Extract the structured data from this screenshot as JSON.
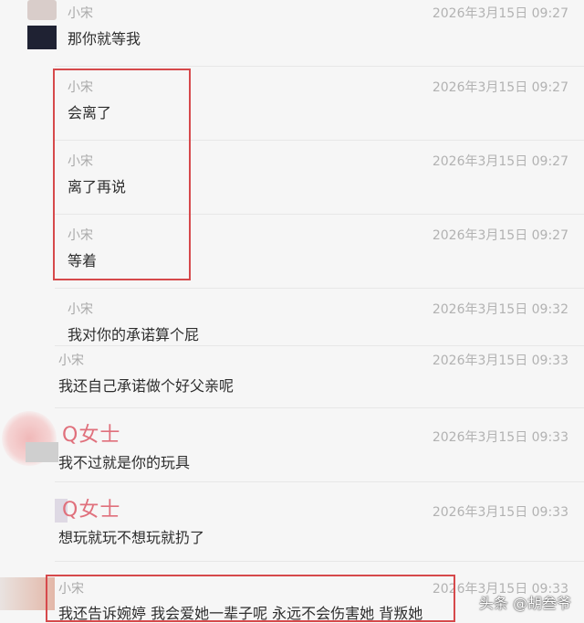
{
  "messages": [
    {
      "sender": "小宋",
      "time": "2026年3月15日 09:27",
      "text": "那你就等我"
    },
    {
      "sender": "小宋",
      "time": "2026年3月15日 09:27",
      "text": "会离了"
    },
    {
      "sender": "小宋",
      "time": "2026年3月15日 09:27",
      "text": "离了再说"
    },
    {
      "sender": "小宋",
      "time": "2026年3月15日 09:27",
      "text": "等着"
    },
    {
      "sender": "小宋",
      "time": "2026年3月15日 09:32",
      "text": "我对你的承诺算个屁"
    },
    {
      "sender": "小宋",
      "time": "2026年3月15日 09:33",
      "text": "我还自己承诺做个好父亲呢"
    },
    {
      "sender": "Q女士",
      "time": "2026年3月15日 09:33",
      "text": "我不过就是你的玩具"
    },
    {
      "sender": "Q女士",
      "time": "2026年3月15日 09:33",
      "text": "想玩就玩不想玩就扔了"
    },
    {
      "sender": "小宋",
      "time": "2026年3月15日 09:33",
      "text": "我还告诉婉婷 我会爱她一辈子呢 永远不会伤害她 背叛她"
    }
  ],
  "watermark": "头条 @胡叁爷",
  "colors": {
    "highlight_border": "#d6494b",
    "q_sender": "#e0707c",
    "background": "#f6f6f6"
  }
}
